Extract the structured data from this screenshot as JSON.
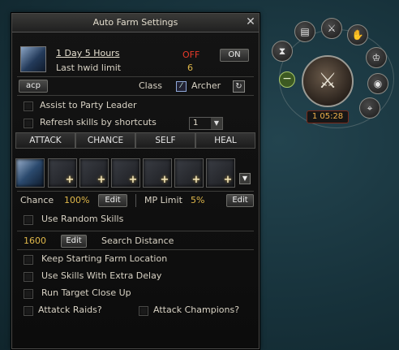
{
  "window": {
    "title": "Auto Farm Settings",
    "close_glyph": "✕"
  },
  "subscription": {
    "duration": "1 Day 5 Hours",
    "status": "OFF",
    "toggle_label": "ON",
    "limit_label": "Last hwid limit",
    "limit_value": "6"
  },
  "class_row": {
    "acp_label": "acp",
    "class_label": "Class",
    "class_value": "Archer"
  },
  "options": {
    "assist_label": "Assist to Party Leader",
    "refresh_label": "Refresh skills by shortcuts",
    "refresh_value": "1"
  },
  "tabs": [
    "ATTACK",
    "CHANCE",
    "SELF",
    "HEAL"
  ],
  "chance_row": {
    "chance_label": "Chance",
    "chance_value": "100%",
    "edit_label": "Edit",
    "mp_label": "MP Limit",
    "mp_value": "5%",
    "mp_edit_label": "Edit"
  },
  "random_skills_label": "Use Random Skills",
  "distance_row": {
    "value": "1600",
    "edit_label": "Edit",
    "label": "Search Distance"
  },
  "checks": {
    "keep_location": "Keep Starting Farm Location",
    "extra_delay": "Use Skills With Extra Delay",
    "run_target": "Run Target Close Up",
    "raids": "Attatck Raids?",
    "champions": "Attack Champions?"
  },
  "timer": "1 05:28",
  "icons": {
    "menu": [
      "book-icon",
      "sword-icon",
      "hand-icon",
      "crown-icon",
      "globe-icon",
      "location-icon",
      "hourglass-icon",
      "minus-icon"
    ]
  }
}
